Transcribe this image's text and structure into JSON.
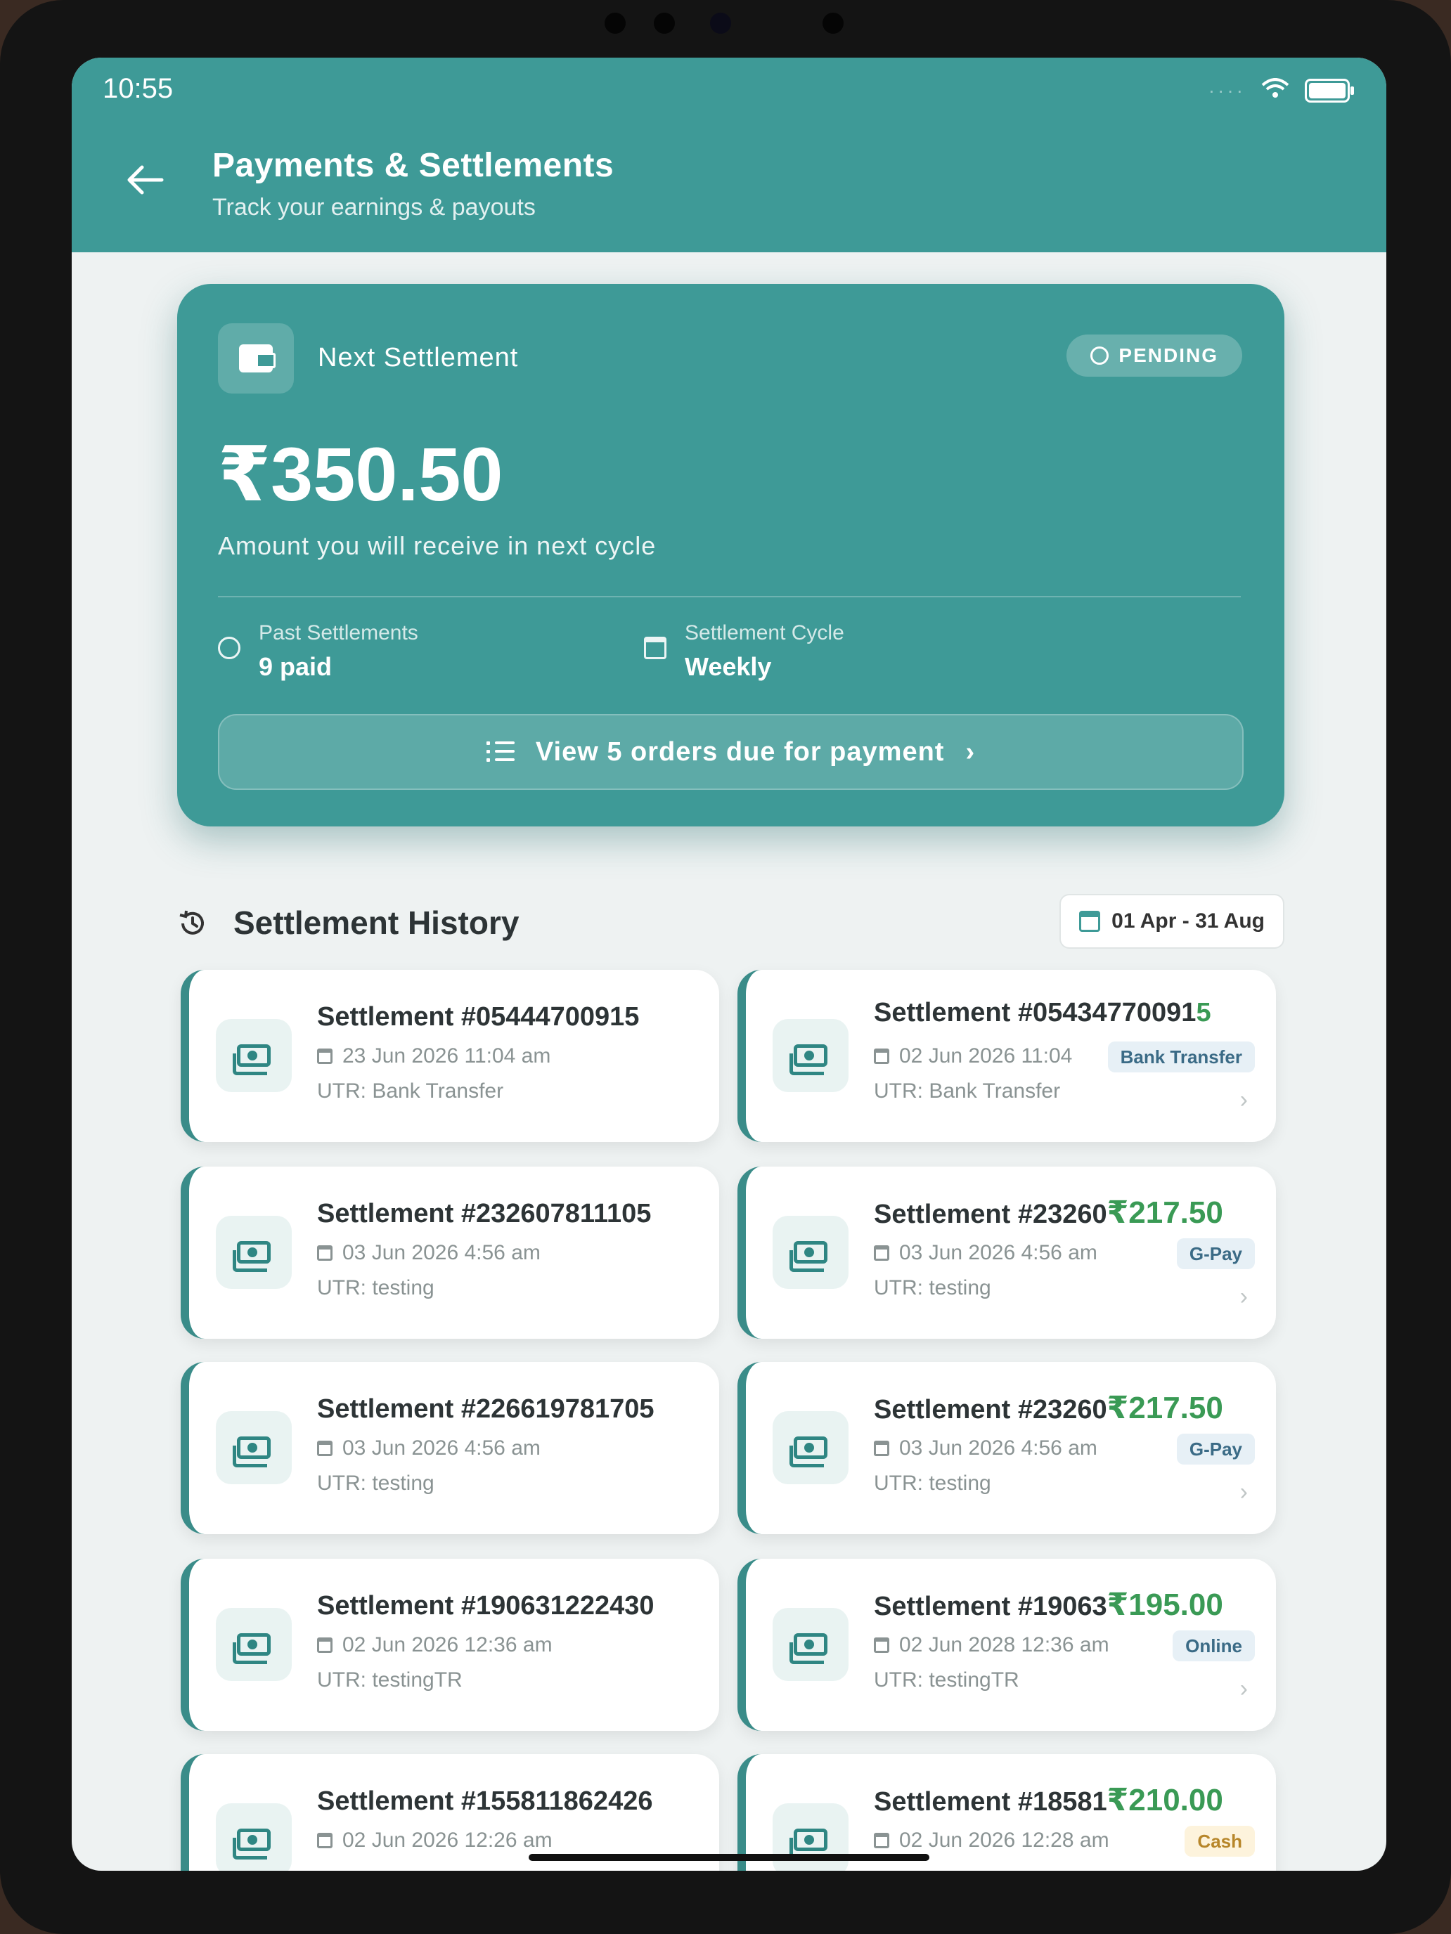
{
  "status_bar": {
    "time": "10:55"
  },
  "header": {
    "title": "Payments & Settlements",
    "subtitle": "Track your earnings & payouts"
  },
  "next_settlement": {
    "label": "Next Settlement",
    "status": "PENDING",
    "amount": "₹350.50",
    "description": "Amount you will receive in next cycle",
    "past_settlements_caption": "Past Settlements",
    "past_settlements_value": "9 paid",
    "cycle_caption": "Settlement Cycle",
    "cycle_value": "Weekly",
    "orders_button": "View 5 orders due for payment"
  },
  "history": {
    "title": "Settlement History",
    "date_range": "01 Apr - 31 Aug",
    "items": [
      {
        "title": "Settlement #05444700915",
        "amount": "",
        "date": "23 Jun 2026  11:04 am",
        "utr": "UTR: Bank Transfer",
        "mode": ""
      },
      {
        "title": "Settlement #05434770091",
        "amount": "5",
        "date": "02 Jun 2026  11:04",
        "utr": "UTR: Bank Transfer",
        "mode": "Bank Transfer"
      },
      {
        "title": "Settlement #232607811105",
        "amount": "",
        "date": "03 Jun 2026  4:56 am",
        "utr": "UTR: testing",
        "mode": ""
      },
      {
        "title": "Settlement #23260",
        "amount": "₹217.50",
        "date": "03 Jun 2026  4:56 am",
        "utr": "UTR: testing",
        "mode": "G-Pay"
      },
      {
        "title": "Settlement #226619781705",
        "amount": "",
        "date": "03 Jun 2026  4:56 am",
        "utr": "UTR: testing",
        "mode": ""
      },
      {
        "title": "Settlement #23260",
        "amount": "₹217.50",
        "date": "03 Jun 2026  4:56 am",
        "utr": "UTR: testing",
        "mode": "G-Pay"
      },
      {
        "title": "Settlement #190631222430",
        "amount": "",
        "date": "02 Jun 2026  12:36 am",
        "utr": "UTR: testingTR",
        "mode": ""
      },
      {
        "title": "Settlement #19063",
        "amount": "₹195.00",
        "date": "02 Jun 2028  12:36 am",
        "utr": "UTR: testingTR",
        "mode": "Online"
      },
      {
        "title": "Settlement #155811862426",
        "amount": "",
        "date": "02 Jun 2026  12:26 am",
        "utr": "",
        "mode": ""
      },
      {
        "title": "Settlement #18581",
        "amount": "₹210.00",
        "date": "02 Jun 2026  12:28 am",
        "utr": "",
        "mode": "Cash"
      }
    ]
  },
  "colors": {
    "primary": "#3e9a97",
    "amount_green": "#3a9a55",
    "background": "#eef2f2"
  }
}
